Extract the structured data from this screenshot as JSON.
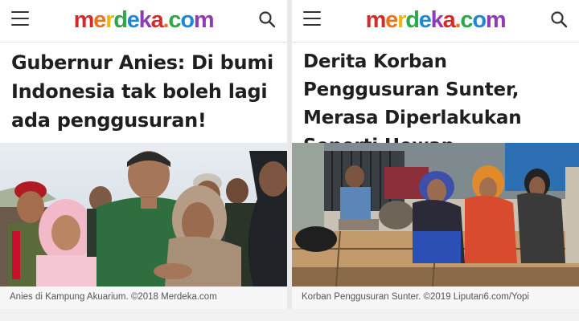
{
  "colors": {
    "logo": [
      "#d62a2a",
      "#e8741b",
      "#f2b705",
      "#2aa84a",
      "#1e88d8",
      "#8e3bb8",
      "#d62a2a",
      "#e8741b",
      "#2aa84a",
      "#1e88d8",
      "#8e3bb8",
      "#d62a2a"
    ],
    "headline": "#1f1f1f",
    "caption_text": "#555555"
  },
  "left_article": {
    "logo_text": "merdeka.com",
    "headline": "Gubernur Anies: Di bumi Indonesia tak boleh lagi ada penggusuran!",
    "caption": "Anies di Kampung Akuarium. ©2018 Merdeka.com"
  },
  "right_article": {
    "logo_text": "merdeka.com",
    "headline": "Derita Korban Penggusuran Sunter, Merasa Diperlakukan Seperti Hewan",
    "caption": "Korban Penggusuran Sunter. ©2019 Liputan6.com/Yopi"
  },
  "icons": {
    "menu": "hamburger-menu-icon",
    "search": "search-icon"
  }
}
